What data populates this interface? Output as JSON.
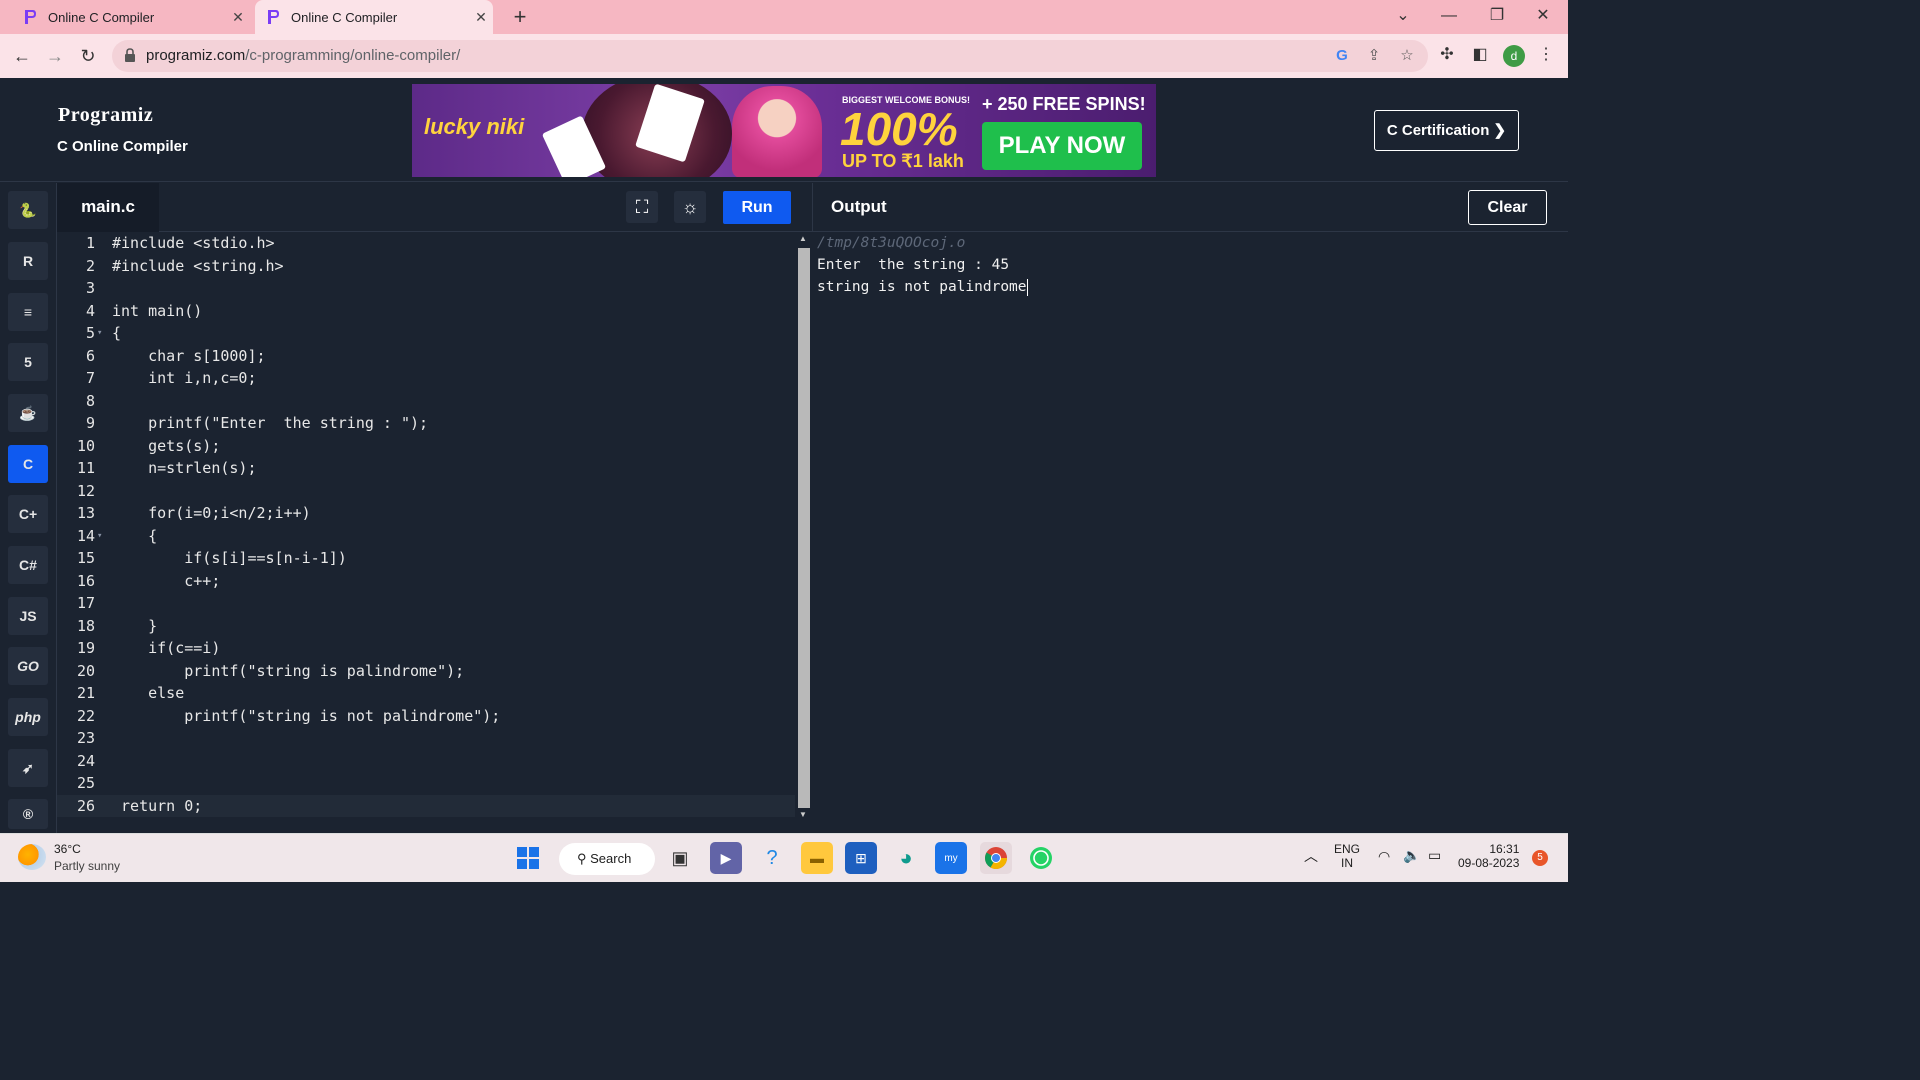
{
  "browser": {
    "tabs": [
      {
        "title": "Online C Compiler",
        "close": "✕"
      },
      {
        "title": "Online C Compiler",
        "close": "✕"
      }
    ],
    "new_tab": "+",
    "url_domain": "programiz.com",
    "url_path": "/c-programming/online-compiler/",
    "profile_initial": "d"
  },
  "header": {
    "logo": "Programiz",
    "subtitle": "C Online Compiler",
    "cert_button": "C Certification ❯"
  },
  "ad": {
    "brand": "lucky niki",
    "bonus": "BIGGEST WELCOME BONUS!",
    "percent": "100%",
    "upto": "UP TO ₹1 lakh",
    "spins": "+ 250 FREE SPINS!",
    "cta": "PLAY NOW"
  },
  "sidebar": {
    "languages": [
      {
        "name": "python",
        "glyph": "🐍"
      },
      {
        "name": "r",
        "glyph": "R"
      },
      {
        "name": "sql",
        "glyph": "≡"
      },
      {
        "name": "html",
        "glyph": "5"
      },
      {
        "name": "java",
        "glyph": "☕"
      },
      {
        "name": "c",
        "glyph": "C"
      },
      {
        "name": "cpp",
        "glyph": "C+"
      },
      {
        "name": "csharp",
        "glyph": "C#"
      },
      {
        "name": "js",
        "glyph": "JS"
      },
      {
        "name": "go",
        "glyph": "GO"
      },
      {
        "name": "php",
        "glyph": "php"
      },
      {
        "name": "swift",
        "glyph": "➶"
      },
      {
        "name": "rust",
        "glyph": "®"
      }
    ],
    "active": "c"
  },
  "editor": {
    "file_tab": "main.c",
    "run_label": "Run",
    "lines": [
      {
        "n": "1",
        "code": "#include <stdio.h>"
      },
      {
        "n": "2",
        "code": "#include <string.h>"
      },
      {
        "n": "3",
        "code": ""
      },
      {
        "n": "4",
        "code": "int main()"
      },
      {
        "n": "5",
        "code": "{",
        "fold": true
      },
      {
        "n": "6",
        "code": "    char s[1000];"
      },
      {
        "n": "7",
        "code": "    int i,n,c=0;"
      },
      {
        "n": "8",
        "code": ""
      },
      {
        "n": "9",
        "code": "    printf(\"Enter  the string : \");"
      },
      {
        "n": "10",
        "code": "    gets(s);"
      },
      {
        "n": "11",
        "code": "    n=strlen(s);"
      },
      {
        "n": "12",
        "code": ""
      },
      {
        "n": "13",
        "code": "    for(i=0;i<n/2;i++)"
      },
      {
        "n": "14",
        "code": "    {",
        "fold": true
      },
      {
        "n": "15",
        "code": "        if(s[i]==s[n-i-1])"
      },
      {
        "n": "16",
        "code": "        c++;"
      },
      {
        "n": "17",
        "code": ""
      },
      {
        "n": "18",
        "code": "    }"
      },
      {
        "n": "19",
        "code": "    if(c==i)"
      },
      {
        "n": "20",
        "code": "        printf(\"string is palindrome\");"
      },
      {
        "n": "21",
        "code": "    else"
      },
      {
        "n": "22",
        "code": "        printf(\"string is not palindrome\");"
      },
      {
        "n": "23",
        "code": ""
      },
      {
        "n": "24",
        "code": ""
      },
      {
        "n": "25",
        "code": ""
      },
      {
        "n": "26",
        "code": " return 0;",
        "current": true
      }
    ]
  },
  "output": {
    "title": "Output",
    "clear_label": "Clear",
    "lines": [
      "/tmp/8t3uQOOcoj.o",
      "Enter  the string : 45",
      "string is not palindrome"
    ]
  },
  "taskbar": {
    "temperature": "36°C",
    "weather": "Partly sunny",
    "search": "Search",
    "lang_top": "ENG",
    "lang_bottom": "IN",
    "time": "16:31",
    "date": "09-08-2023",
    "notif_count": "5"
  }
}
